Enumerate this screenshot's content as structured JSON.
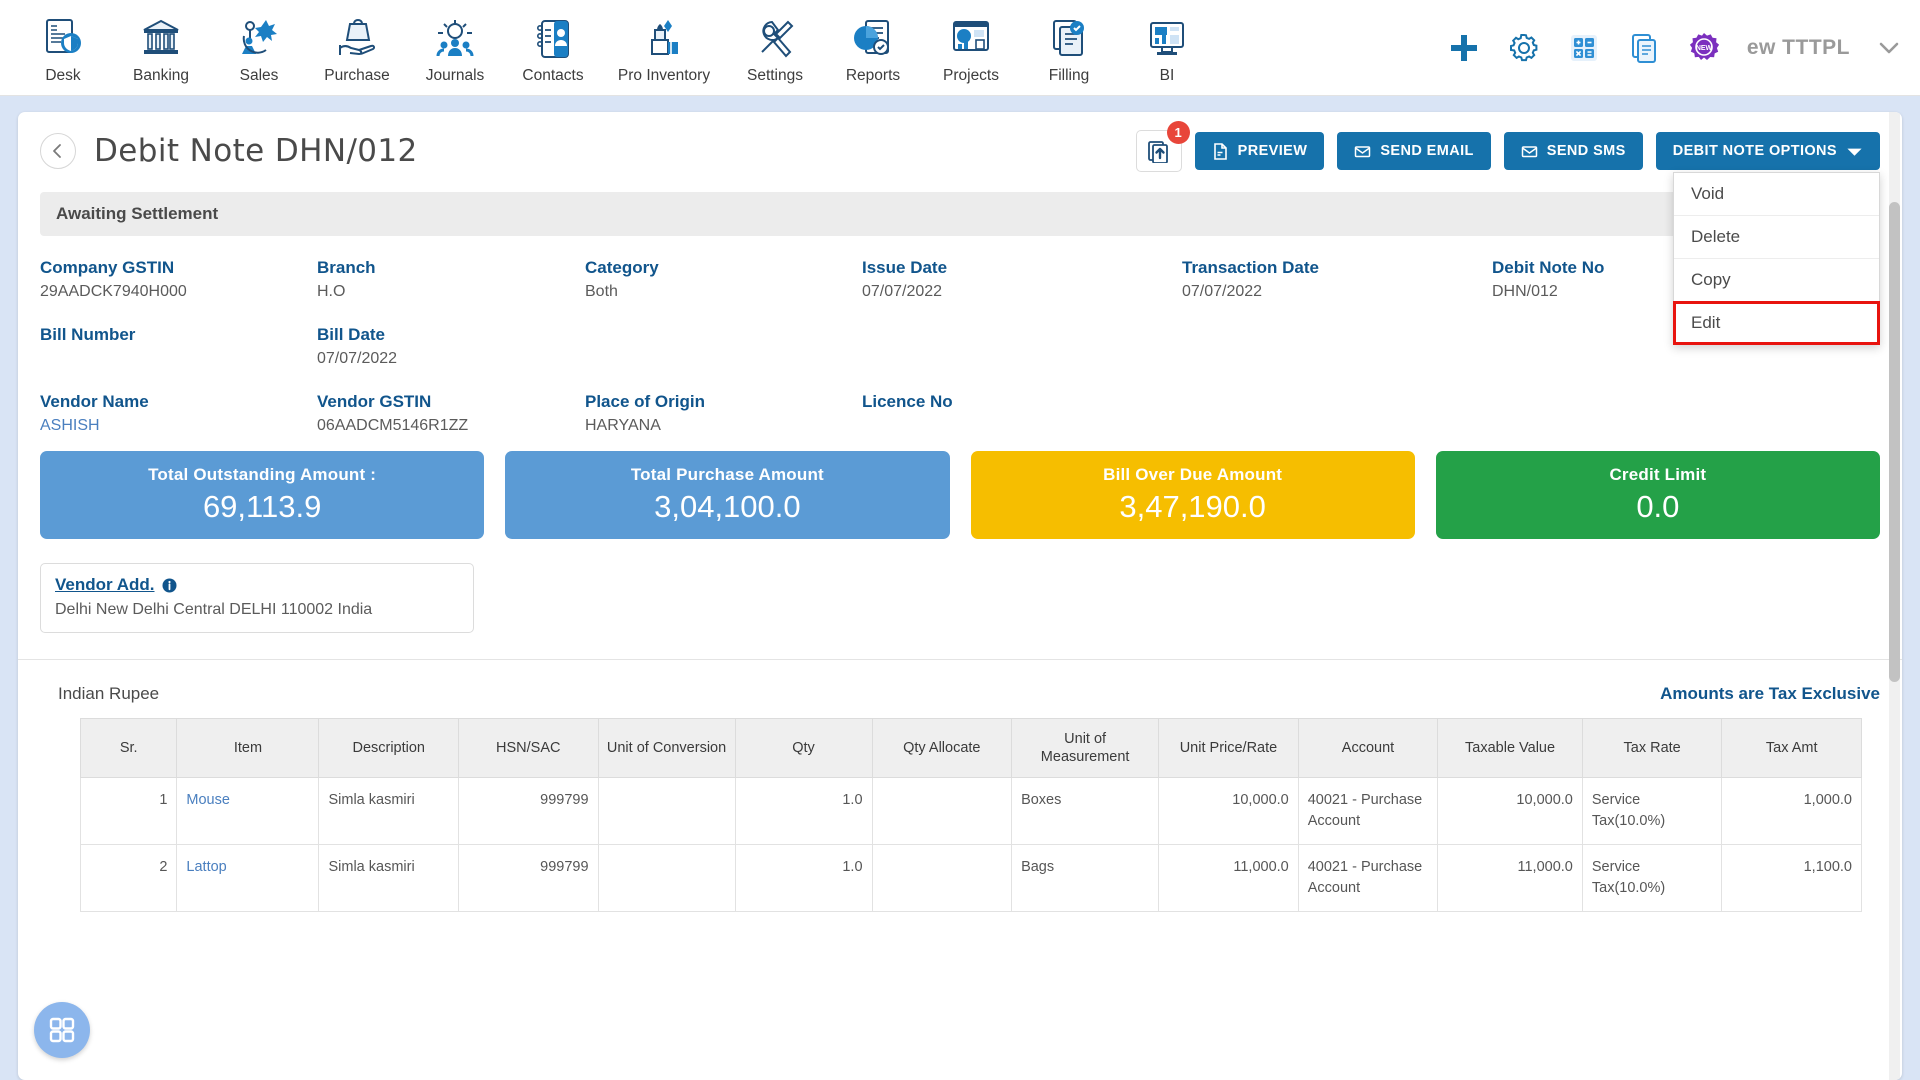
{
  "topnav": {
    "items": [
      {
        "label": "Desk",
        "icon": "desk-icon"
      },
      {
        "label": "Banking",
        "icon": "bank-icon"
      },
      {
        "label": "Sales",
        "icon": "sales-icon"
      },
      {
        "label": "Purchase",
        "icon": "purchase-icon"
      },
      {
        "label": "Journals",
        "icon": "journals-icon"
      },
      {
        "label": "Contacts",
        "icon": "contacts-icon"
      },
      {
        "label": "Pro Inventory",
        "icon": "inventory-icon"
      },
      {
        "label": "Settings",
        "icon": "settings-icon"
      },
      {
        "label": "Reports",
        "icon": "reports-icon"
      },
      {
        "label": "Projects",
        "icon": "projects-icon"
      },
      {
        "label": "Filling",
        "icon": "filling-icon"
      },
      {
        "label": "BI",
        "icon": "bi-icon"
      }
    ],
    "right": {
      "add_icon": "plus-icon",
      "settings_icon": "gear-icon",
      "calculator_icon": "calculator-icon",
      "notes_icon": "document-icon",
      "new_badge_icon": "new-badge-icon",
      "new_badge_text": "NEW",
      "org_name": "ew TTTPL",
      "chevron_icon": "chevron-down-icon"
    }
  },
  "header": {
    "back_icon": "chevron-left-icon",
    "title": "Debit Note DHN/012",
    "upload_icon": "upload-file-icon",
    "upload_badge": "1",
    "preview_label": "PREVIEW",
    "send_email_label": "SEND EMAIL",
    "send_sms_label": "SEND SMS",
    "options_label": "DEBIT NOTE OPTIONS",
    "options_caret_icon": "caret-down-icon"
  },
  "dropdown": {
    "items": [
      {
        "label": "Void",
        "highlighted": false
      },
      {
        "label": "Delete",
        "highlighted": false
      },
      {
        "label": "Copy",
        "highlighted": false
      },
      {
        "label": "Edit",
        "highlighted": true
      }
    ]
  },
  "status": {
    "text": "Awaiting Settlement"
  },
  "details": {
    "row1": [
      {
        "label": "Company GSTIN",
        "value": "29AADCK7940H000"
      },
      {
        "label": "Branch",
        "value": "H.O"
      },
      {
        "label": "Category",
        "value": "Both"
      },
      {
        "label": "Issue Date",
        "value": "07/07/2022"
      },
      {
        "label": "Transaction Date",
        "value": "07/07/2022"
      },
      {
        "label": "Debit Note No",
        "value": "DHN/012"
      }
    ],
    "row2": [
      {
        "label": "Bill Number",
        "value": ""
      },
      {
        "label": "Bill Date",
        "value": "07/07/2022"
      }
    ],
    "row3": [
      {
        "label": "Vendor Name",
        "value": "ASHISH",
        "is_link": true
      },
      {
        "label": "Vendor GSTIN",
        "value": "06AADCM5146R1ZZ"
      },
      {
        "label": "Place of Origin",
        "value": "HARYANA"
      },
      {
        "label": "Licence No",
        "value": ""
      }
    ]
  },
  "summary_cards": [
    {
      "title": "Total Outstanding Amount :",
      "value": "69,113.9",
      "color": "#5b9bd5"
    },
    {
      "title": "Total Purchase Amount",
      "value": "3,04,100.0",
      "color": "#5b9bd5"
    },
    {
      "title": "Bill Over Due Amount",
      "value": "3,47,190.0",
      "color": "#f6be00"
    },
    {
      "title": "Credit Limit",
      "value": "0.0",
      "color": "#24a148"
    }
  ],
  "vendor_address": {
    "title": "Vendor Add.",
    "info_icon": "info-icon",
    "text": "Delhi New Delhi Central DELHI 110002 India"
  },
  "line_items": {
    "currency_label": "Indian Rupee",
    "tax_note": "Amounts are Tax Exclusive",
    "columns": [
      "Sr.",
      "Item",
      "Description",
      "HSN/SAC",
      "Unit of Conversion",
      "Qty",
      "Qty Allocate",
      "Unit of Measurement",
      "Unit Price/Rate",
      "Account",
      "Taxable Value",
      "Tax Rate",
      "Tax Amt"
    ],
    "rows": [
      {
        "sr": "1",
        "item": "Mouse",
        "description": "Simla kasmiri",
        "hsn": "999799",
        "unit_conversion": "",
        "qty": "1.0",
        "qty_allocate": "",
        "uom": "Boxes",
        "unit_price": "10,000.0",
        "account": "40021 - Purchase Account",
        "taxable_value": "10,000.0",
        "tax_rate": "Service Tax(10.0%)",
        "tax_amt": "1,000.0"
      },
      {
        "sr": "2",
        "item": "Lattop",
        "description": "Simla kasmiri",
        "hsn": "999799",
        "unit_conversion": "",
        "qty": "1.0",
        "qty_allocate": "",
        "uom": "Bags",
        "unit_price": "11,000.0",
        "account": "40021 - Purchase Account",
        "taxable_value": "11,000.0",
        "tax_rate": "Service Tax(10.0%)",
        "tax_amt": "1,100.0"
      }
    ]
  },
  "fab": {
    "icon": "grid-apps-icon"
  },
  "colors": {
    "brand_blue": "#1672ab",
    "label_blue": "#11558c",
    "card_blue": "#5b9bd5",
    "card_yellow": "#f6be00",
    "card_green": "#24a148",
    "badge_red": "#e8463a",
    "highlight_red": "#e8140f"
  }
}
